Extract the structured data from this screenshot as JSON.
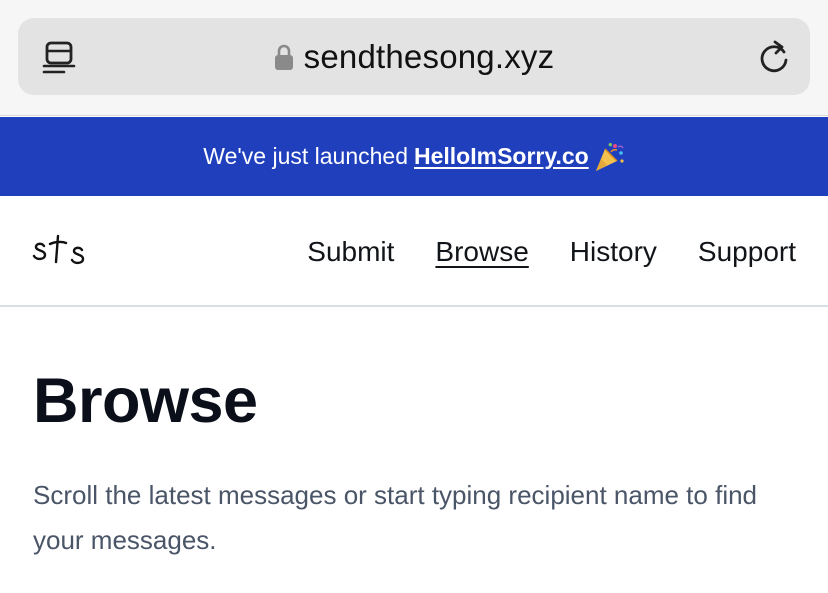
{
  "browser": {
    "url": "sendthesong.xyz",
    "icons": {
      "reader": "reader-mode-icon",
      "lock": "lock-icon",
      "reload": "reload-icon"
    }
  },
  "banner": {
    "text": "We've just launched",
    "link": "HelloImSorry.co",
    "icon": "party-popper-icon",
    "background": "#1f3fbd"
  },
  "nav": {
    "logo": "sts",
    "links": [
      "Submit",
      "Browse",
      "History",
      "Support"
    ],
    "active": "Browse"
  },
  "main": {
    "title": "Browse",
    "description": "Scroll the latest messages or start typing recipient name to find your messages."
  }
}
